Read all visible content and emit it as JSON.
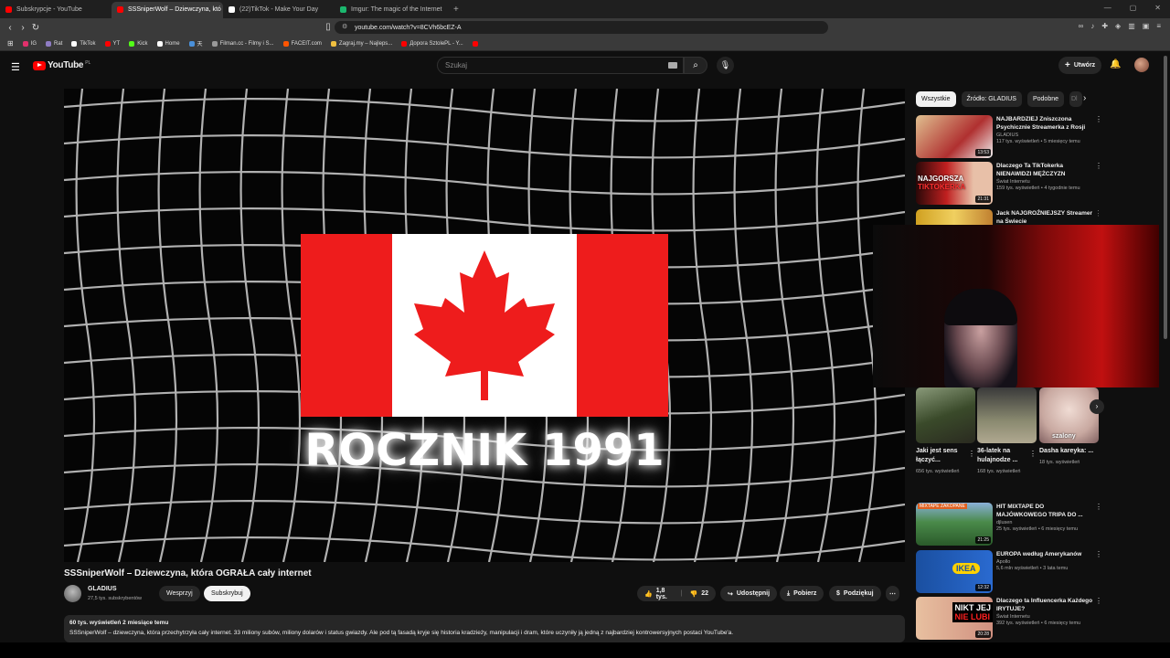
{
  "browser": {
    "tabs": [
      {
        "label": "Subskrypcje - YouTube",
        "color": "#ff0000"
      },
      {
        "label": "SSSniperWolf – Dziewczyna, któ",
        "color": "#ff0000"
      },
      {
        "label": "(22)TikTok - Make Your Day",
        "color": "#ffffff"
      },
      {
        "label": "Imgur: The magic of the Internet",
        "color": "#1bb76e"
      }
    ],
    "url": "youtube.com/watch?v=8CVh6bcEZ-A",
    "bookmarks": [
      {
        "label": "IG",
        "color": "#e1306c"
      },
      {
        "label": "Rat",
        "color": "#8e7cc3"
      },
      {
        "label": "TikTok",
        "color": "#ffffff"
      },
      {
        "label": "YT",
        "color": "#ff0000"
      },
      {
        "label": "Kick",
        "color": "#53fc18"
      },
      {
        "label": "Home",
        "color": "#ffffff"
      },
      {
        "label": "天",
        "color": "#4a90d9"
      },
      {
        "label": "Filman.cc - Filmy i S...",
        "color": "#999999"
      },
      {
        "label": "FACEIT.com",
        "color": "#ff5500"
      },
      {
        "label": "Zagraj.my – Najleps...",
        "color": "#f0c040"
      },
      {
        "label": "Дорога SztolePL - Y...",
        "color": "#ff0000"
      },
      {
        "label": "",
        "color": "#ff0000"
      }
    ]
  },
  "header": {
    "logo": "YouTube",
    "region": "PL",
    "search_placeholder": "Szukaj",
    "create_label": "Utwórz"
  },
  "video": {
    "overlay_text": "ROCZNIK 1991",
    "title": "SSSniperWolf – Dziewczyna, która OGRAŁA cały internet",
    "channel": "GLADIUS",
    "subscribers": "27,5 tys. subskrybentów",
    "join_label": "Wesprzyj",
    "subscribe_label": "Subskrybuj",
    "likes": "1,8 tys.",
    "dislikes": "22",
    "share_label": "Udostępnij",
    "download_label": "Pobierz",
    "thanks_label": "Podziękuj",
    "views_date": "60 tys. wyświetleń  2 miesiące temu",
    "description": "SSSniperWolf – dziewczyna, która przechytrzyła cały internet. 33 miliony subów, miliony dolarów i status gwiazdy. Ale pod tą fasadą kryje się historia kradzieży, manipulacji i dram, które uczyniły ją jedną z najbardziej kontrowersyjnych postaci YouTube'a."
  },
  "chips": [
    "Wszystkie",
    "Źródło: GLADIUS",
    "Podobne",
    "Dl"
  ],
  "recommendations_top": [
    {
      "title": "NAJBARDZIEJ Zniszczona Psychicznie Streamerka z Rosji",
      "channel": "GLADIUS",
      "meta": "117 tys. wyświetleń • 5 miesięcy temu",
      "duration": "13:53",
      "thumb_color": "#c9a070"
    },
    {
      "title": "Dlaczego Ta TikTokerka NIENAWIDZI MĘŻCZYZN",
      "channel": "Świat Internetu",
      "meta": "159 tys. wyświetleń • 4 tygodnie temu",
      "duration": "21:31",
      "thumb_color": "#8a2020"
    },
    {
      "title": "Jack NAJGROŹNIEJSZY Streamer na Świecie",
      "channel": "",
      "meta": "",
      "duration": "",
      "thumb_color": "#d0a020"
    }
  ],
  "shorts": [
    {
      "title": "Jaki jest sens łączyć...",
      "views": "656 tys. wyświetleń",
      "color": "#4a5a3a",
      "overlay": ""
    },
    {
      "title": "36-latek na hulajnodze ...",
      "views": "168 tys. wyświetleń",
      "color": "#6a6a5a",
      "overlay": ""
    },
    {
      "title": "Dasha kareyka: ...",
      "views": "18 tys. wyświetleń",
      "color": "#d8c8c0",
      "overlay": "szalony"
    }
  ],
  "recommendations_bottom": [
    {
      "title": "HIT MIXTAPE DO MAJÓWKOWEGO TRIPA DO ...",
      "channel": "djlusen",
      "meta": "25 tys. wyświetleń • 6 miesięcy temu",
      "duration": "21:25",
      "thumb_color": "#4a8a4a"
    },
    {
      "title": "EUROPA według Amerykanów",
      "channel": "Apollo",
      "meta": "5,6 mln wyświetleń • 3 lata temu",
      "duration": "12:32",
      "thumb_color": "#1a4fa0"
    },
    {
      "title": "Dlaczego ta Influencerka Każdego IRYTUJE?",
      "channel": "Świat Internetu",
      "meta": "392 tys. wyświetleń • 6 miesięcy temu",
      "duration": "20:28",
      "thumb_color": "#e0b090"
    }
  ]
}
